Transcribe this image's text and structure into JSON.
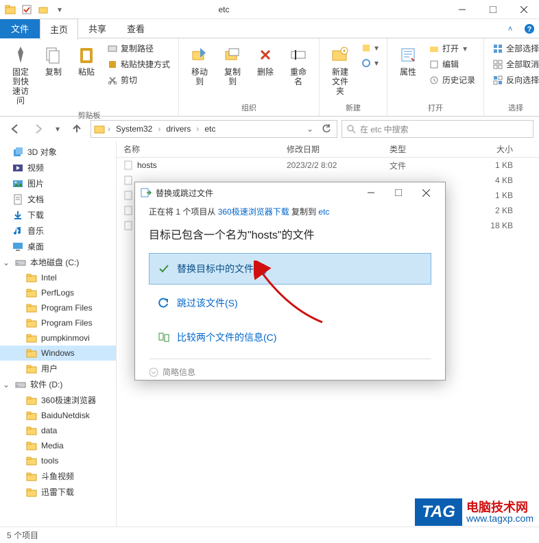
{
  "window": {
    "title": "etc"
  },
  "tabs": {
    "file": "文件",
    "home": "主页",
    "share": "共享",
    "view": "查看"
  },
  "ribbon": {
    "clipboard": {
      "label": "剪贴板",
      "pin": "固定到快\n速访问",
      "copy": "复制",
      "paste": "粘贴",
      "copy_path": "复制路径",
      "paste_shortcut": "粘贴快捷方式",
      "cut": "剪切"
    },
    "organize": {
      "label": "组织",
      "move_to": "移动到",
      "copy_to": "复制到",
      "delete": "删除",
      "rename": "重命名"
    },
    "new": {
      "label": "新建",
      "new_folder": "新建\n文件夹"
    },
    "open": {
      "label": "打开",
      "properties": "属性",
      "open": "打开",
      "edit": "编辑",
      "history": "历史记录"
    },
    "select": {
      "label": "选择",
      "select_all": "全部选择",
      "select_none": "全部取消",
      "invert": "反向选择"
    }
  },
  "breadcrumb": [
    "System32",
    "drivers",
    "etc"
  ],
  "search": {
    "placeholder": "在 etc 中搜索"
  },
  "tree": [
    {
      "label": "3D 对象",
      "icon": "3d"
    },
    {
      "label": "视频",
      "icon": "video"
    },
    {
      "label": "图片",
      "icon": "pictures"
    },
    {
      "label": "文档",
      "icon": "docs"
    },
    {
      "label": "下载",
      "icon": "downloads"
    },
    {
      "label": "音乐",
      "icon": "music"
    },
    {
      "label": "桌面",
      "icon": "desktop"
    },
    {
      "label": "本地磁盘 (C:)",
      "icon": "disk",
      "expandable": true
    },
    {
      "label": "Intel",
      "icon": "folder",
      "indent": 1
    },
    {
      "label": "PerfLogs",
      "icon": "folder",
      "indent": 1
    },
    {
      "label": "Program Files",
      "icon": "folder",
      "indent": 1
    },
    {
      "label": "Program Files",
      "icon": "folder",
      "indent": 1
    },
    {
      "label": "pumpkinmovi",
      "icon": "folder",
      "indent": 1
    },
    {
      "label": "Windows",
      "icon": "folder",
      "indent": 1,
      "selected": true
    },
    {
      "label": "用户",
      "icon": "folder",
      "indent": 1
    },
    {
      "label": "软件 (D:)",
      "icon": "disk",
      "expandable": true
    },
    {
      "label": "360极速浏览器",
      "icon": "folder",
      "indent": 1
    },
    {
      "label": "BaiduNetdisk",
      "icon": "folder",
      "indent": 1
    },
    {
      "label": "data",
      "icon": "folder",
      "indent": 1
    },
    {
      "label": "Media",
      "icon": "folder",
      "indent": 1
    },
    {
      "label": "tools",
      "icon": "folder",
      "indent": 1
    },
    {
      "label": "斗鱼视频",
      "icon": "folder",
      "indent": 1
    },
    {
      "label": "迅雷下载",
      "icon": "folder",
      "indent": 1
    }
  ],
  "file_header": {
    "name": "名称",
    "date": "修改日期",
    "type": "类型",
    "size": "大小"
  },
  "files": [
    {
      "name": "hosts",
      "date": "2023/2/2 8:02",
      "type": "文件",
      "size": "1 KB"
    },
    {
      "name": "",
      "date": "",
      "type": "",
      "size": "4 KB"
    },
    {
      "name": "",
      "date": "",
      "type": "",
      "size": "1 KB"
    },
    {
      "name": "",
      "date": "",
      "type": "",
      "size": "2 KB"
    },
    {
      "name": "",
      "date": "",
      "type": "",
      "size": "18 KB"
    }
  ],
  "status": {
    "count": "5 个项目"
  },
  "dialog": {
    "title": "替换或跳过文件",
    "line1_prefix": "正在将 1 个项目从 ",
    "line1_src": "360极速浏览器下载",
    "line1_mid": " 复制到 ",
    "line1_dst": "etc",
    "heading": "目标已包含一个名为\"hosts\"的文件",
    "opt_replace": "替换目标中的文件(R)",
    "opt_skip": "跳过该文件(S)",
    "opt_compare": "比较两个文件的信息(C)",
    "footer": "简略信息"
  },
  "watermark": {
    "tag": "TAG",
    "cn": "电脑技术网",
    "url": "www.tagxp.com"
  }
}
